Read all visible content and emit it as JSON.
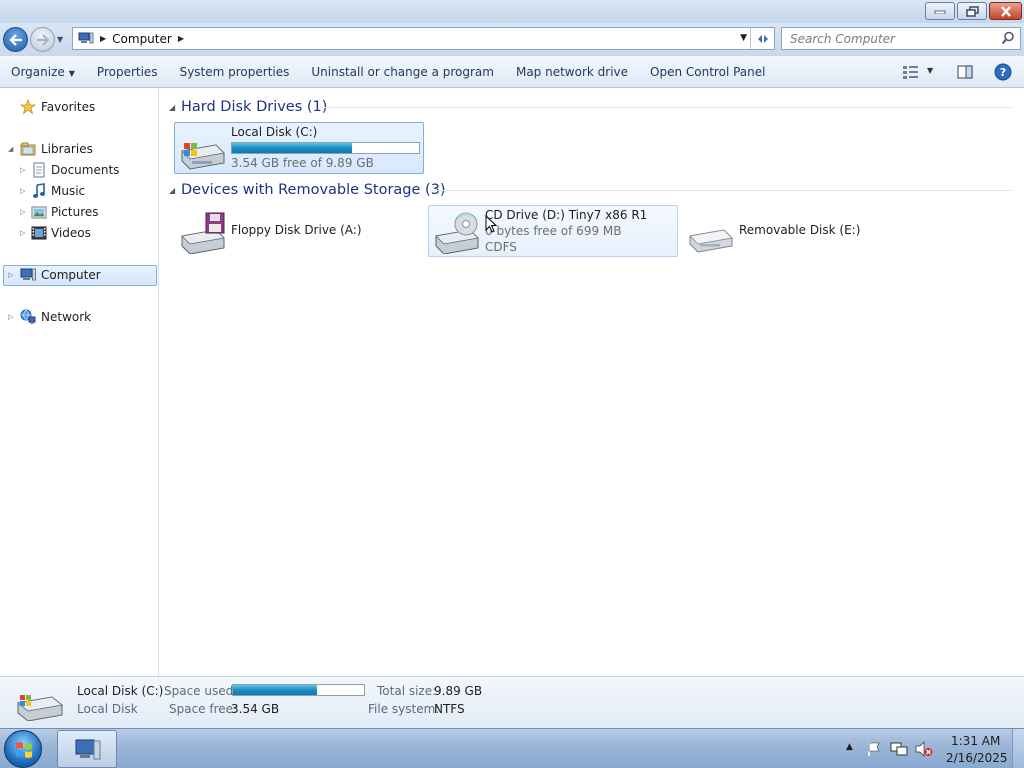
{
  "window": {
    "minimize_label": "",
    "maximize_label": "",
    "close_label": ""
  },
  "address": {
    "crumbs": [
      "Computer"
    ],
    "search_placeholder": "Search Computer"
  },
  "toolbar": {
    "organize": "Organize",
    "properties": "Properties",
    "system_properties": "System properties",
    "uninstall": "Uninstall or change a program",
    "map_drive": "Map network drive",
    "control_panel": "Open Control Panel"
  },
  "nav": {
    "favorites": "Favorites",
    "libraries": "Libraries",
    "documents": "Documents",
    "music": "Music",
    "pictures": "Pictures",
    "videos": "Videos",
    "computer": "Computer",
    "network": "Network"
  },
  "groups": {
    "hdd": {
      "title": "Hard Disk Drives (1)"
    },
    "removable": {
      "title": "Devices with Removable Storage (3)"
    }
  },
  "drives": {
    "c": {
      "name": "Local Disk (C:)",
      "free_text": "3.54 GB free of 9.89 GB",
      "used_fraction": 0.642
    },
    "a": {
      "name": "Floppy Disk Drive (A:)"
    },
    "d": {
      "name": "CD Drive (D:) Tiny7 x86 R1",
      "free_text": "0 bytes free of 699 MB",
      "fs": "CDFS"
    },
    "e": {
      "name": "Removable Disk (E:)"
    }
  },
  "details": {
    "name": "Local Disk (C:)",
    "type": "Local Disk",
    "space_used_label": "Space used:",
    "space_free_label": "Space free:",
    "space_free": "3.54 GB",
    "total_size_label": "Total size:",
    "total_size": "9.89 GB",
    "fs_label": "File system:",
    "fs": "NTFS",
    "used_fraction": 0.642
  },
  "taskbar": {
    "time": "1:31 AM",
    "date": "2/16/2025"
  }
}
